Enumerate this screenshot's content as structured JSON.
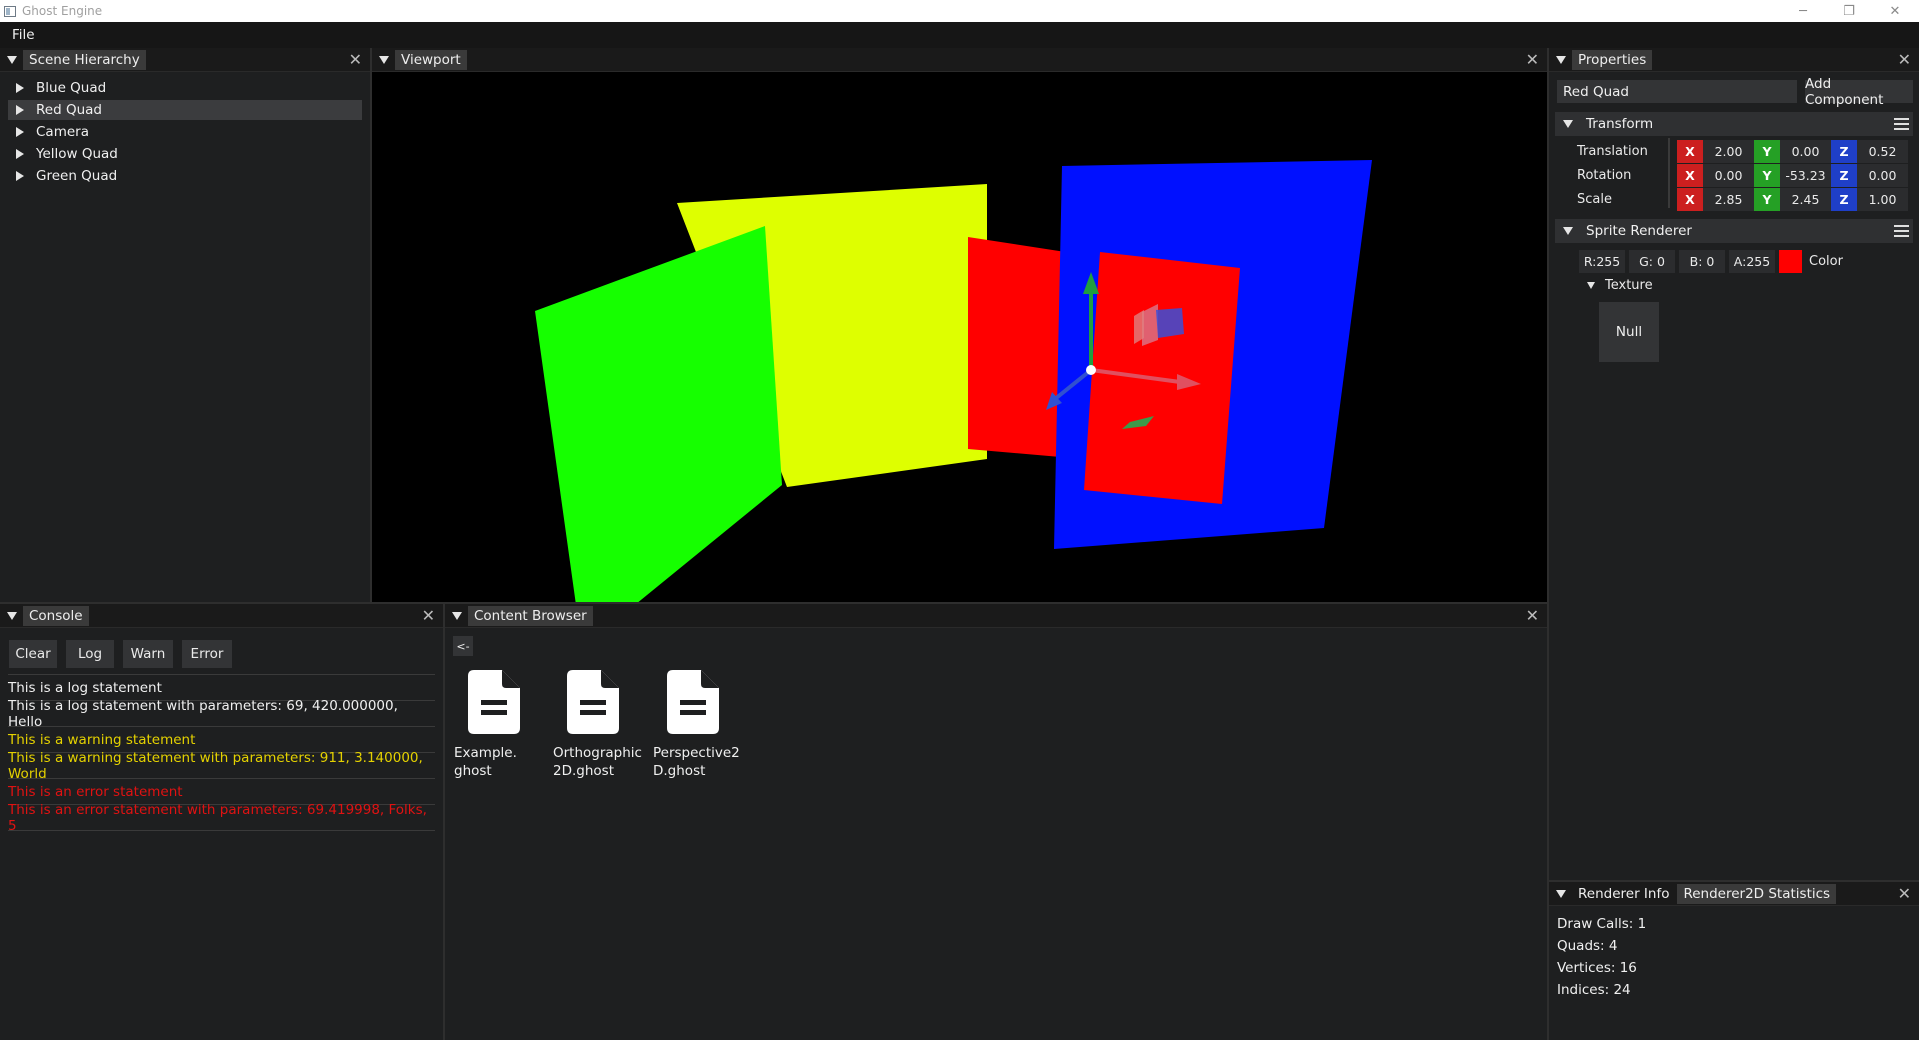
{
  "window": {
    "title": "Ghost Engine",
    "controls": {
      "minimize": "─",
      "restore": "❐",
      "close": "✕"
    }
  },
  "menubar": {
    "items": [
      "File"
    ]
  },
  "scene_hierarchy": {
    "tab": "Scene Hierarchy",
    "items": [
      {
        "label": "Blue Quad",
        "selected": false
      },
      {
        "label": "Red Quad",
        "selected": true
      },
      {
        "label": "Camera",
        "selected": false
      },
      {
        "label": "Yellow Quad",
        "selected": false
      },
      {
        "label": "Green Quad",
        "selected": false
      }
    ]
  },
  "viewport": {
    "tab": "Viewport",
    "quad_colors": {
      "green": "#16ff00",
      "yellow": "#deff00",
      "red": "#ff0000",
      "blue": "#0010ff"
    }
  },
  "properties": {
    "tab": "Properties",
    "entity_name": "Red Quad",
    "add_component": "Add Component",
    "transform": {
      "title": "Transform",
      "rows": [
        {
          "label": "Translation",
          "x": "2.00",
          "y": "0.00",
          "z": "0.52"
        },
        {
          "label": "Rotation",
          "x": "0.00",
          "y": "-53.23",
          "z": "0.00"
        },
        {
          "label": "Scale",
          "x": "2.85",
          "y": "2.45",
          "z": "1.00"
        }
      ],
      "axis_labels": {
        "x": "X",
        "y": "Y",
        "z": "Z"
      }
    },
    "sprite_renderer": {
      "title": "Sprite Renderer",
      "r": "R:255",
      "g": "G: 0",
      "b": "B: 0",
      "a": "A:255",
      "color_label": "Color",
      "color_swatch": "#ff0000",
      "texture_label": "Texture",
      "texture_value": "Null"
    }
  },
  "console": {
    "tab": "Console",
    "buttons": {
      "clear": "Clear",
      "log": "Log",
      "warn": "Warn",
      "error": "Error"
    },
    "lines": [
      {
        "level": "log",
        "text": "This is a log statement"
      },
      {
        "level": "log",
        "text": "This is a log statement with parameters: 69, 420.000000, Hello"
      },
      {
        "level": "warn",
        "text": "This is a warning statement"
      },
      {
        "level": "warn",
        "text": "This is a warning statement with parameters: 911, 3.140000, World"
      },
      {
        "level": "error",
        "text": "This is an error statement"
      },
      {
        "level": "error",
        "text": "This is an error statement with parameters: 69.419998, Folks, 5"
      }
    ]
  },
  "content_browser": {
    "tab": "Content Browser",
    "back_button": "<-",
    "files": [
      {
        "line1": "Example.",
        "line2": "ghost"
      },
      {
        "line1": "Orthographic",
        "line2": "2D.ghost"
      },
      {
        "line1": "Perspective2",
        "line2": "D.ghost"
      }
    ]
  },
  "renderer_info": {
    "tab": "Renderer Info",
    "tab2": "Renderer2D Statistics",
    "stats": {
      "draw_calls": "Draw Calls: 1",
      "quads": "Quads: 4",
      "vertices": "Vertices: 16",
      "indices": "Indices: 24"
    }
  }
}
